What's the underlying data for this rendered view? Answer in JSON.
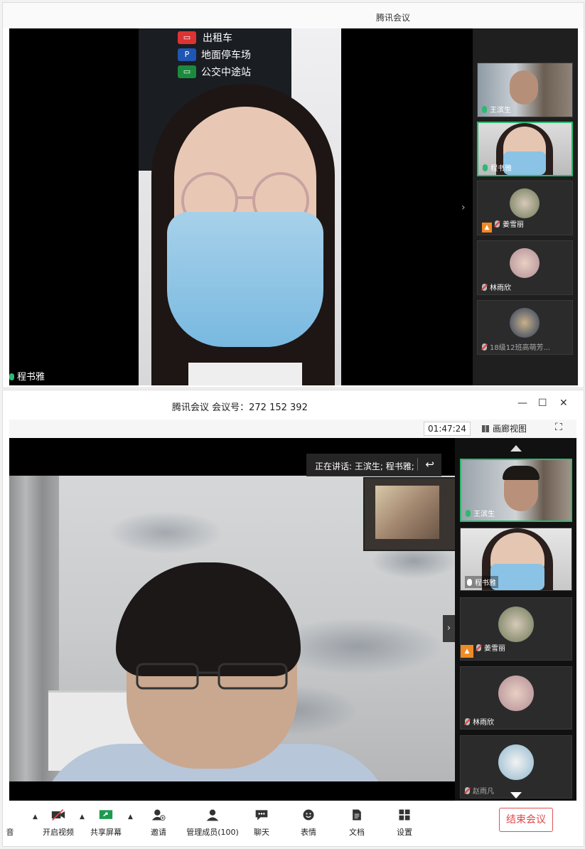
{
  "top_window": {
    "title": "腾讯会议",
    "main_speaker_name": "程书雅",
    "sign_rows": [
      "出租车",
      "地面停车场",
      "公交中途站"
    ],
    "thumbnails": [
      {
        "name": "王滨生",
        "mic": "on"
      },
      {
        "name": "程书雅",
        "mic": "on",
        "active": true
      },
      {
        "name": "姜雪丽",
        "mic": "muted",
        "host": true
      },
      {
        "name": "林雨欣",
        "mic": "muted"
      },
      {
        "name": "18级12班高萌芳...",
        "mic": "muted"
      }
    ],
    "expand_arrow": "›"
  },
  "bottom_window": {
    "title": "腾讯会议  会议号：272 152 392",
    "window_controls": {
      "minimize": "—",
      "maximize": "☐",
      "close": "✕"
    },
    "timer": "01:47:24",
    "gallery_view": "画廊视图",
    "fullscreen": "⛶",
    "speaking_label": "正在讲话: 王滨生; 程书雅;",
    "speaking_icon": "↩",
    "side_arrow": "›",
    "thumbnails": [
      {
        "name": "王滨生",
        "mic": "on",
        "active": true
      },
      {
        "name": "程书雅",
        "mic": "on-white"
      },
      {
        "name": "姜雪丽",
        "mic": "muted",
        "host": true
      },
      {
        "name": "林雨欣",
        "mic": "muted"
      },
      {
        "name": "赵雨凡",
        "mic": "muted"
      }
    ],
    "toolbar": {
      "audio": "音",
      "video": "开启视频",
      "share": "共享屏幕",
      "invite": "邀请",
      "members": "管理成员(100)",
      "chat": "聊天",
      "emoji": "表情",
      "docs": "文档",
      "settings": "设置",
      "end": "结束会议"
    }
  },
  "colors": {
    "accent_green": "#2eb872",
    "end_red": "#e04646",
    "host_orange": "#f08a24"
  }
}
